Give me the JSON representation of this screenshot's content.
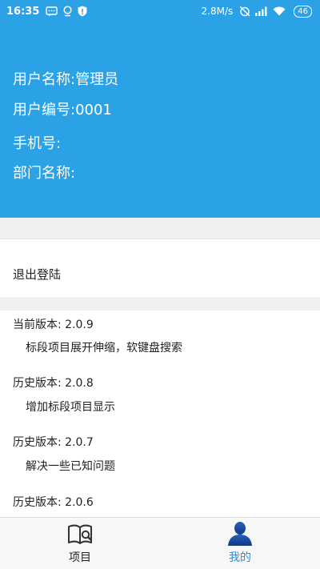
{
  "status_bar": {
    "time": "16:35",
    "speed": "2.8M/s",
    "battery": "46",
    "icons": [
      "message-icon",
      "location-icon",
      "shield-icon",
      "alarm-off-icon",
      "signal-icon",
      "wifi-icon"
    ]
  },
  "profile": {
    "username": "用户名称:管理员",
    "user_id": "用户编号:0001",
    "phone": "手机号:",
    "department": "部门名称:"
  },
  "actions": {
    "logout": "退出登陆"
  },
  "versions": [
    {
      "title": "当前版本: 2.0.9",
      "desc": "标段项目展开伸缩，软键盘搜索"
    },
    {
      "title": "历史版本: 2.0.8",
      "desc": "增加标段项目显示"
    },
    {
      "title": "历史版本: 2.0.7",
      "desc": "解决一些已知问题"
    },
    {
      "title": "历史版本: 2.0.6",
      "desc": ""
    }
  ],
  "bottom_nav": {
    "items": [
      {
        "label": "项目",
        "icon": "book-search-icon",
        "active": false
      },
      {
        "label": "我的",
        "icon": "user-icon",
        "active": true
      }
    ]
  },
  "colors": {
    "header": "#2ba1e6",
    "active_tab": "#2a8fd6",
    "gap": "#f0f0f0"
  }
}
